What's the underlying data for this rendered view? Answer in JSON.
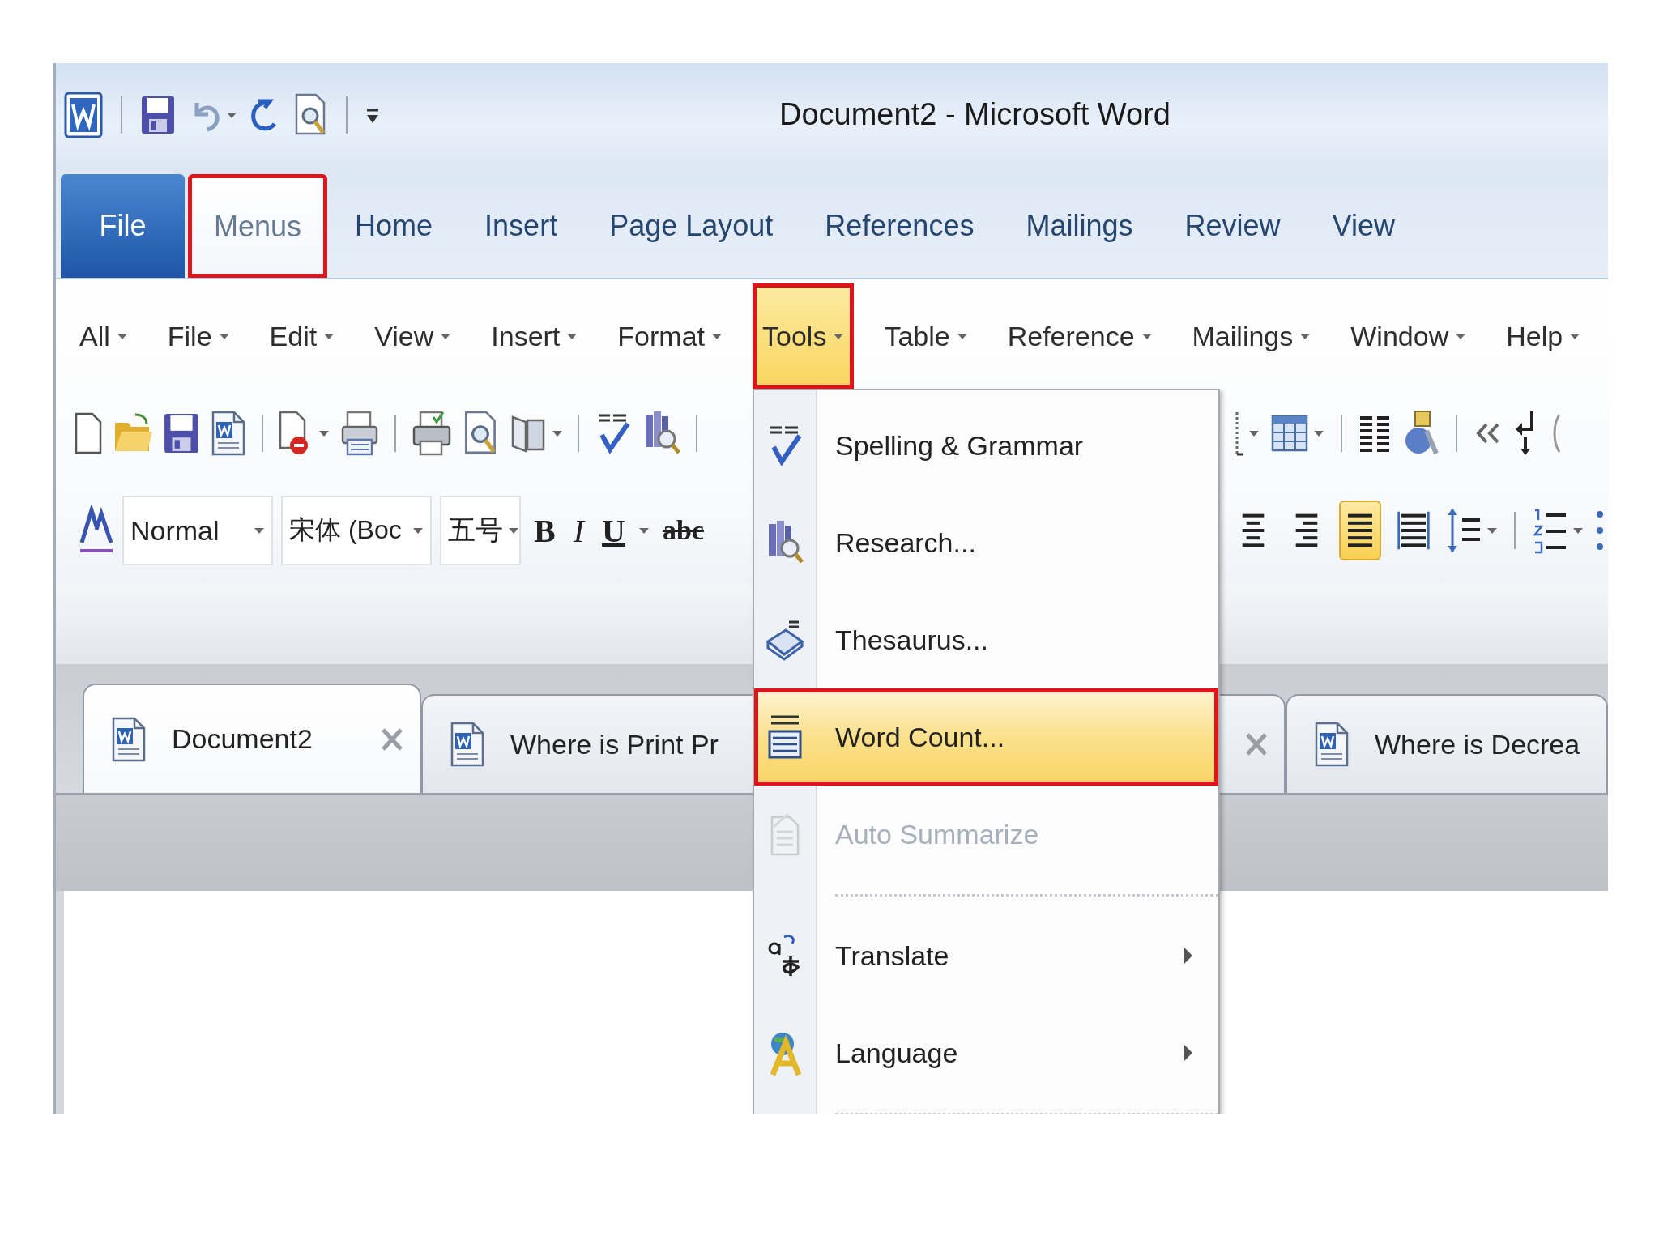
{
  "title_bar": {
    "title": "Document2 - Microsoft Word"
  },
  "ribbon_tabs": [
    {
      "label": "File",
      "kind": "backstage",
      "selected": false,
      "annotated": false
    },
    {
      "label": "Menus",
      "kind": "tab",
      "selected": true,
      "annotated": true
    },
    {
      "label": "Home",
      "kind": "tab",
      "selected": false,
      "annotated": false
    },
    {
      "label": "Insert",
      "kind": "tab",
      "selected": false,
      "annotated": false
    },
    {
      "label": "Page Layout",
      "kind": "tab",
      "selected": false,
      "annotated": false
    },
    {
      "label": "References",
      "kind": "tab",
      "selected": false,
      "annotated": false
    },
    {
      "label": "Mailings",
      "kind": "tab",
      "selected": false,
      "annotated": false
    },
    {
      "label": "Review",
      "kind": "tab",
      "selected": false,
      "annotated": false
    },
    {
      "label": "View",
      "kind": "tab",
      "selected": false,
      "annotated": false
    }
  ],
  "menu_bar": [
    {
      "label": "All",
      "open": false,
      "annotated": false
    },
    {
      "label": "File",
      "open": false,
      "annotated": false
    },
    {
      "label": "Edit",
      "open": false,
      "annotated": false
    },
    {
      "label": "View",
      "open": false,
      "annotated": false
    },
    {
      "label": "Insert",
      "open": false,
      "annotated": false
    },
    {
      "label": "Format",
      "open": false,
      "annotated": false
    },
    {
      "label": "Tools",
      "open": true,
      "annotated": true
    },
    {
      "label": "Table",
      "open": false,
      "annotated": false
    },
    {
      "label": "Reference",
      "open": false,
      "annotated": false
    },
    {
      "label": "Mailings",
      "open": false,
      "annotated": false
    },
    {
      "label": "Window",
      "open": false,
      "annotated": false
    },
    {
      "label": "Help",
      "open": false,
      "annotated": false
    }
  ],
  "formatting": {
    "style": "Normal",
    "font": "宋体 (Boc",
    "size": "五号",
    "buttons": [
      {
        "label": "B",
        "kind": "bold"
      },
      {
        "label": "I",
        "kind": "italic"
      },
      {
        "label": "U",
        "kind": "underline"
      },
      {
        "label": "abc",
        "kind": "strikethrough"
      }
    ]
  },
  "alignment": [
    {
      "selected": false
    },
    {
      "selected": false
    },
    {
      "selected": true
    },
    {
      "selected": false
    }
  ],
  "tools_menu": [
    {
      "kind": "item",
      "label": "Spelling & Grammar",
      "highlighted": false,
      "disabled": false,
      "annotated": false,
      "submenu": false
    },
    {
      "kind": "item",
      "label": "Research...",
      "highlighted": false,
      "disabled": false,
      "annotated": false,
      "submenu": false
    },
    {
      "kind": "item",
      "label": "Thesaurus...",
      "highlighted": false,
      "disabled": false,
      "annotated": false,
      "submenu": false
    },
    {
      "kind": "item",
      "label": "Word Count...",
      "highlighted": true,
      "disabled": false,
      "annotated": true,
      "submenu": false
    },
    {
      "kind": "item",
      "label": "Auto Summarize",
      "highlighted": false,
      "disabled": true,
      "annotated": false,
      "submenu": false
    },
    {
      "kind": "separator"
    },
    {
      "kind": "item",
      "label": "Translate",
      "highlighted": false,
      "disabled": false,
      "annotated": false,
      "submenu": true
    },
    {
      "kind": "item",
      "label": "Language",
      "highlighted": false,
      "disabled": false,
      "annotated": false,
      "submenu": true
    },
    {
      "kind": "separator"
    }
  ],
  "document_tabs": [
    {
      "title": "Document2",
      "selected": true
    },
    {
      "title": "Where is Print Pr",
      "selected": false
    },
    {
      "title": "Where is Decrea",
      "selected": false
    }
  ]
}
